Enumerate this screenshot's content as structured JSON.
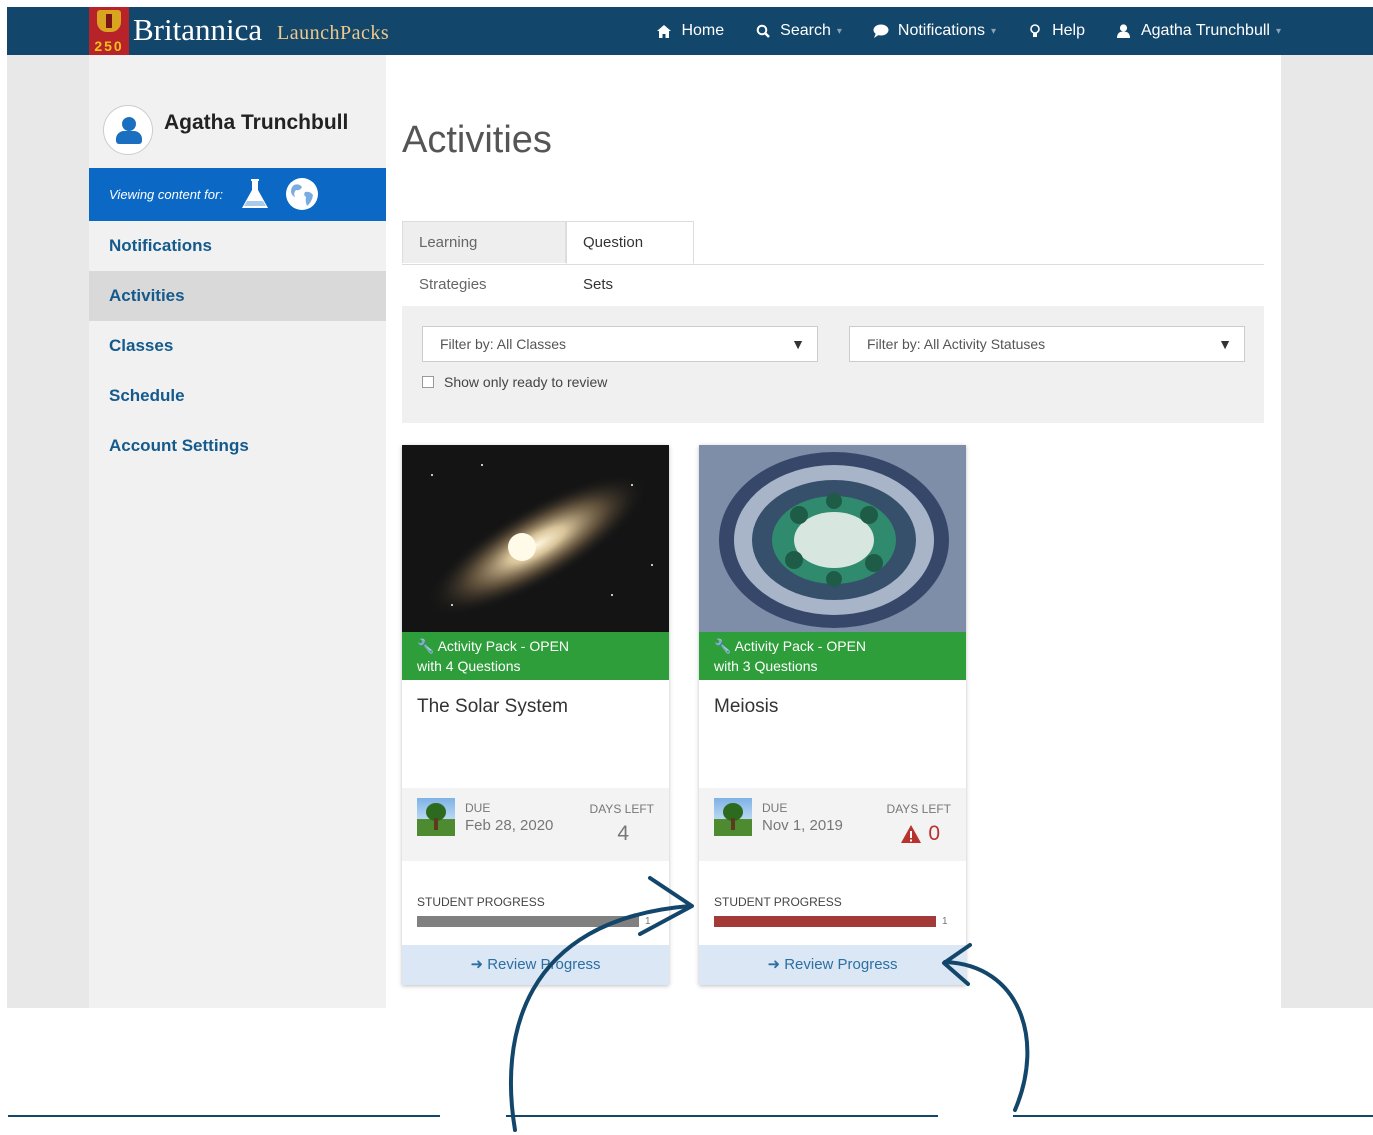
{
  "brand": {
    "name": "Britannica",
    "product": "LaunchPacks",
    "badge_number": "250"
  },
  "nav": {
    "home": "Home",
    "search": "Search",
    "notifications": "Notifications",
    "help": "Help",
    "user": "Agatha Trunchbull"
  },
  "sidebar": {
    "user_name": "Agatha Trunchbull",
    "viewing_label": "Viewing content for:",
    "items": [
      {
        "label": "Notifications"
      },
      {
        "label": "Activities"
      },
      {
        "label": "Classes"
      },
      {
        "label": "Schedule"
      },
      {
        "label": "Account Settings"
      }
    ]
  },
  "main": {
    "title": "Activities",
    "tabs": [
      {
        "label": "Learning Strategies"
      },
      {
        "label": "Question Sets"
      }
    ],
    "filters": {
      "classes": "Filter by: All Classes",
      "statuses": "Filter by: All Activity Statuses",
      "ready_checkbox": "Show only ready to review"
    }
  },
  "cards": [
    {
      "banner_line1": "Activity Pack - OPEN",
      "banner_line2": "with 4 Questions",
      "title": "The Solar System",
      "due_label": "DUE",
      "due_date": "Feb 28, 2020",
      "days_left_label": "DAYS LEFT",
      "days_left": "4",
      "progress_label": "STUDENT PROGRESS",
      "progress_count": "1",
      "progress_fraction": 1.0,
      "progress_color": "#808080",
      "review_label": "Review Progress"
    },
    {
      "banner_line1": "Activity Pack - OPEN",
      "banner_line2": "with 3 Questions",
      "title": "Meiosis",
      "due_label": "DUE",
      "due_date": "Nov 1, 2019",
      "days_left_label": "DAYS LEFT",
      "days_left": "0",
      "progress_label": "STUDENT PROGRESS",
      "progress_count": "1",
      "progress_fraction": 1.0,
      "progress_color": "#a33a38",
      "review_label": "Review Progress"
    }
  ],
  "colors": {
    "nav_bg": "#13466b",
    "sidebar_accent": "#0b68c4",
    "link": "#145a8c",
    "banner_green": "#2e9e3a",
    "annotation": "#13466b"
  }
}
